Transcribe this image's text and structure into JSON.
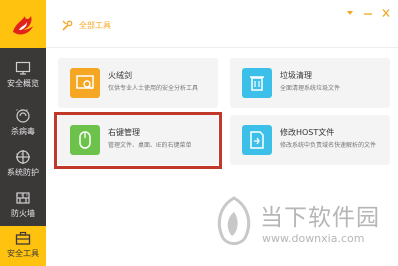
{
  "header": {
    "breadcrumb_label": "全部工具",
    "breadcrumb_icon": "tools-icon"
  },
  "window": {
    "buttons": [
      "dropdown-icon",
      "minimize-icon",
      "close-icon"
    ]
  },
  "sidebar": {
    "items": [
      {
        "label": "安全概览",
        "icon": "monitor-icon",
        "active": false
      },
      {
        "label": "杀病毒",
        "icon": "virus-scan-icon",
        "active": false
      },
      {
        "label": "系统防护",
        "icon": "crosshair-icon",
        "active": false
      },
      {
        "label": "防火墙",
        "icon": "firewall-icon",
        "active": false
      },
      {
        "label": "安全工具",
        "icon": "toolbox-icon",
        "active": true
      }
    ]
  },
  "tools": [
    {
      "title": "火绒剑",
      "desc": "仅供专业人士使用的安全分析工具",
      "color": "#f5a623",
      "icon": "analyzer-icon"
    },
    {
      "title": "垃圾清理",
      "desc": "全面清理系统垃圾文件",
      "color": "#3cc0ea",
      "icon": "trash-icon"
    },
    {
      "title": "右键管理",
      "desc": "管理文件、桌面、IE的右键菜单",
      "color": "#6cc24a",
      "icon": "mouse-icon"
    },
    {
      "title": "修改HOST文件",
      "desc": "修改系统中负责域名快速解析的文件",
      "color": "#3cc0ea",
      "icon": "host-file-icon"
    }
  ],
  "watermark": {
    "text": "当下软件园",
    "url": "www.downxia.com"
  },
  "colors": {
    "accent": "#ffc20e",
    "sidebar": "#3b3838",
    "highlight": "#c0392b"
  }
}
